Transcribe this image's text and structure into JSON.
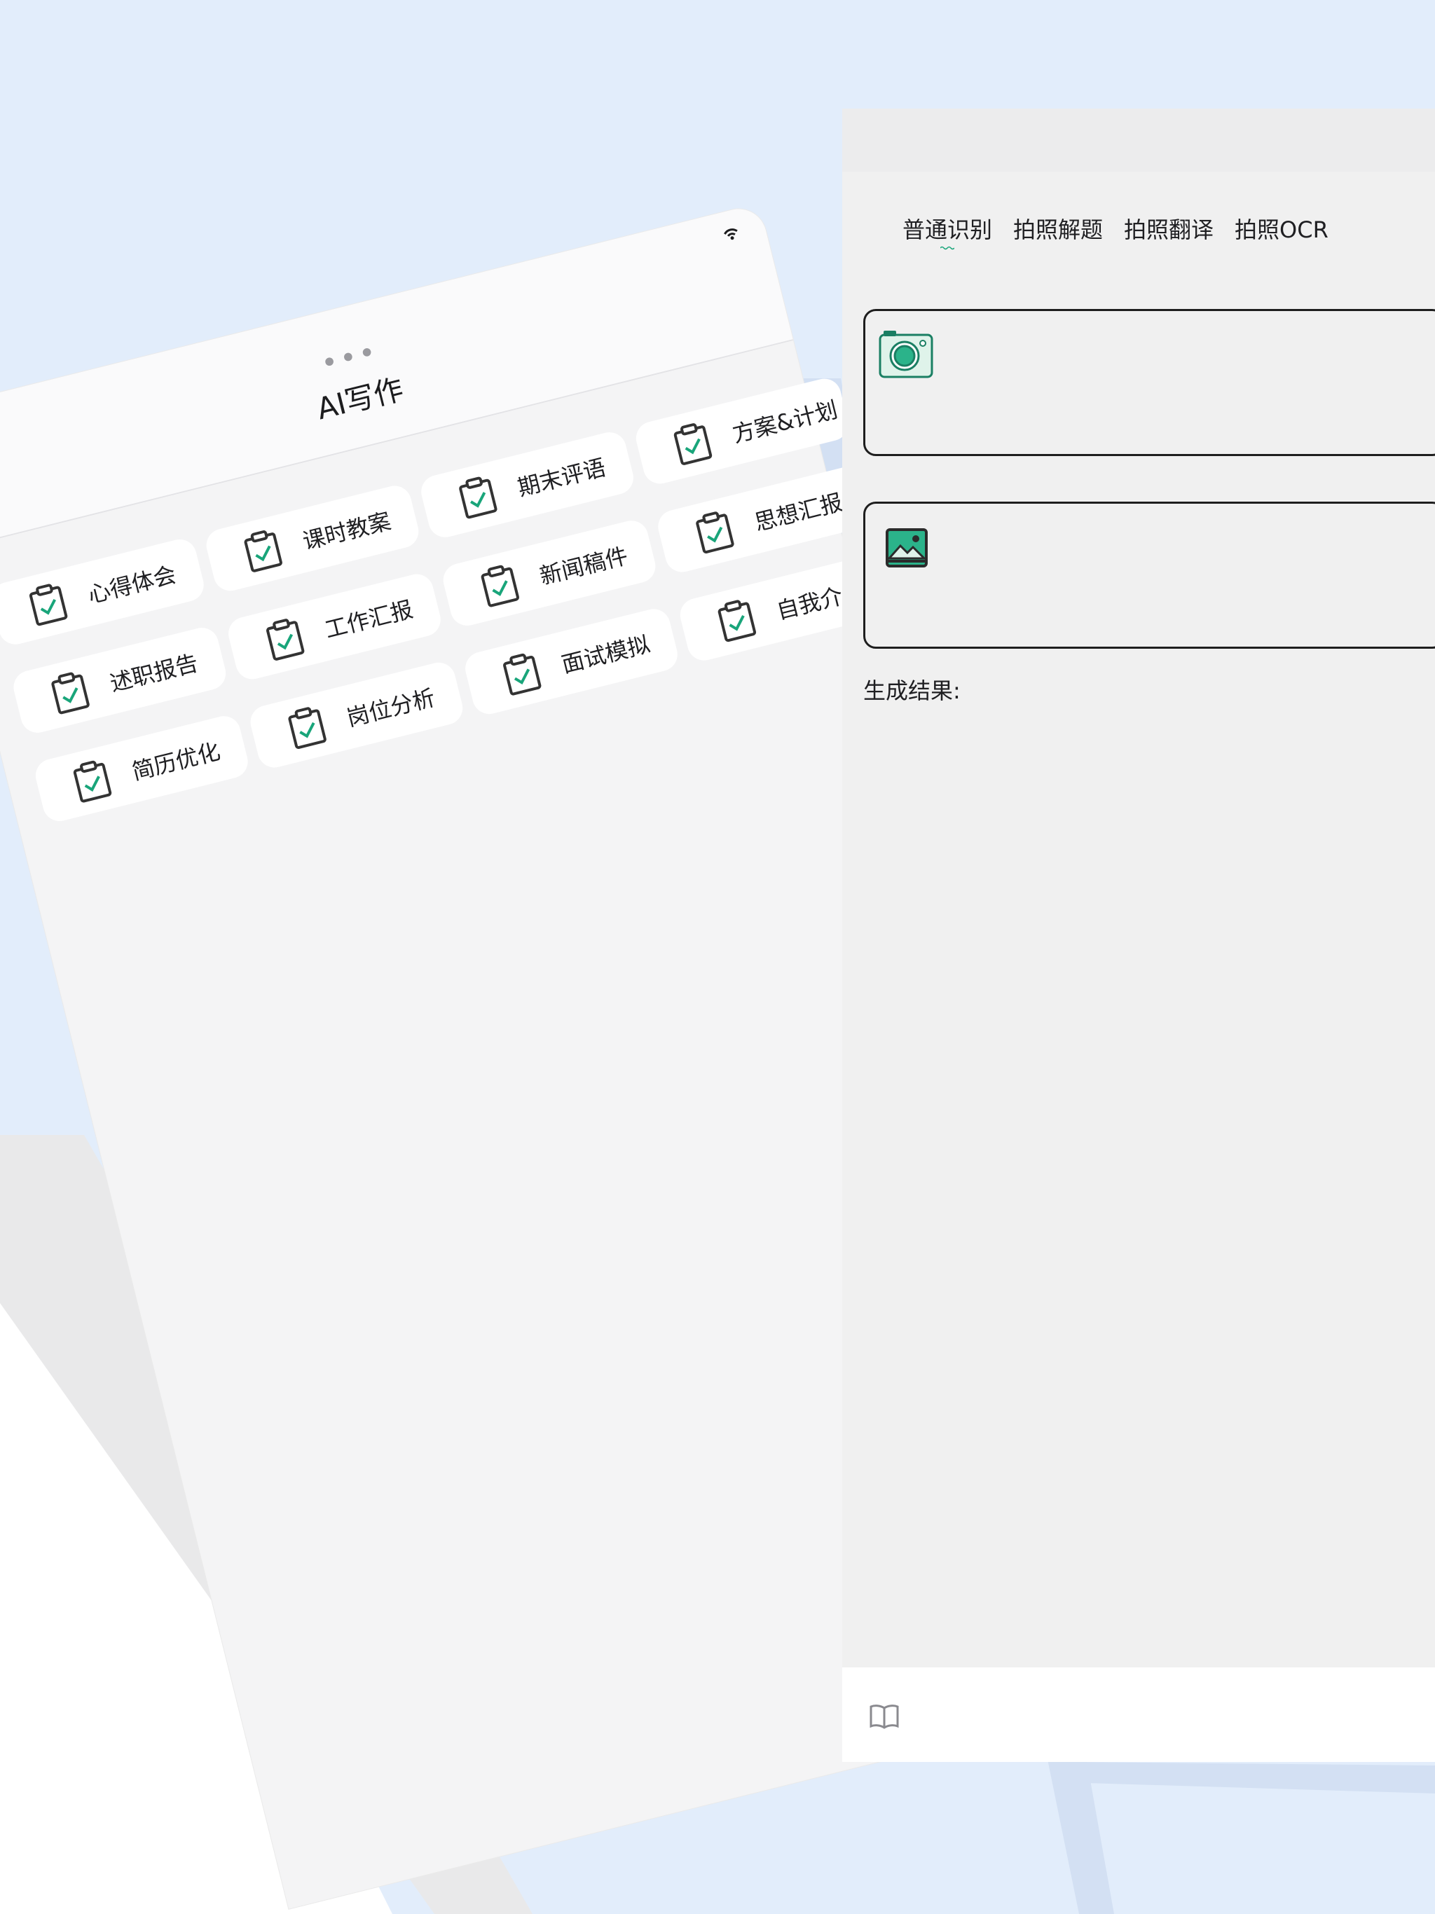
{
  "colors": {
    "accent_green": "#19a57a",
    "background_blue": "#e2edfb",
    "tile_background": "#ffffff",
    "card_border": "#1e1e1e"
  },
  "tilted_screen": {
    "menu_dots": "•••",
    "title": "AI写作",
    "status_icon": "wifi-icon",
    "tile_icon": "clipboard-check-icon",
    "tiles": [
      {
        "label": "心得体会"
      },
      {
        "label": "课时教案"
      },
      {
        "label": "期末评语"
      },
      {
        "label": "方案&计划"
      },
      {
        "label": "述职报告"
      },
      {
        "label": "工作汇报"
      },
      {
        "label": "新闻稿件"
      },
      {
        "label": "思想汇报"
      },
      {
        "label": "简历优化"
      },
      {
        "label": "岗位分析"
      },
      {
        "label": "面试模拟"
      },
      {
        "label": "自我介绍"
      }
    ]
  },
  "right_screen": {
    "tabs": [
      {
        "label": "普通识别",
        "active": true
      },
      {
        "label": "拍照解题",
        "active": false
      },
      {
        "label": "拍照翻译",
        "active": false
      },
      {
        "label": "拍照OCR",
        "active": false
      }
    ],
    "camera_card_icon": "camera-icon",
    "image_card_icon": "image-icon",
    "result_label": "生成结果:",
    "bottom_icon": "book-icon"
  }
}
